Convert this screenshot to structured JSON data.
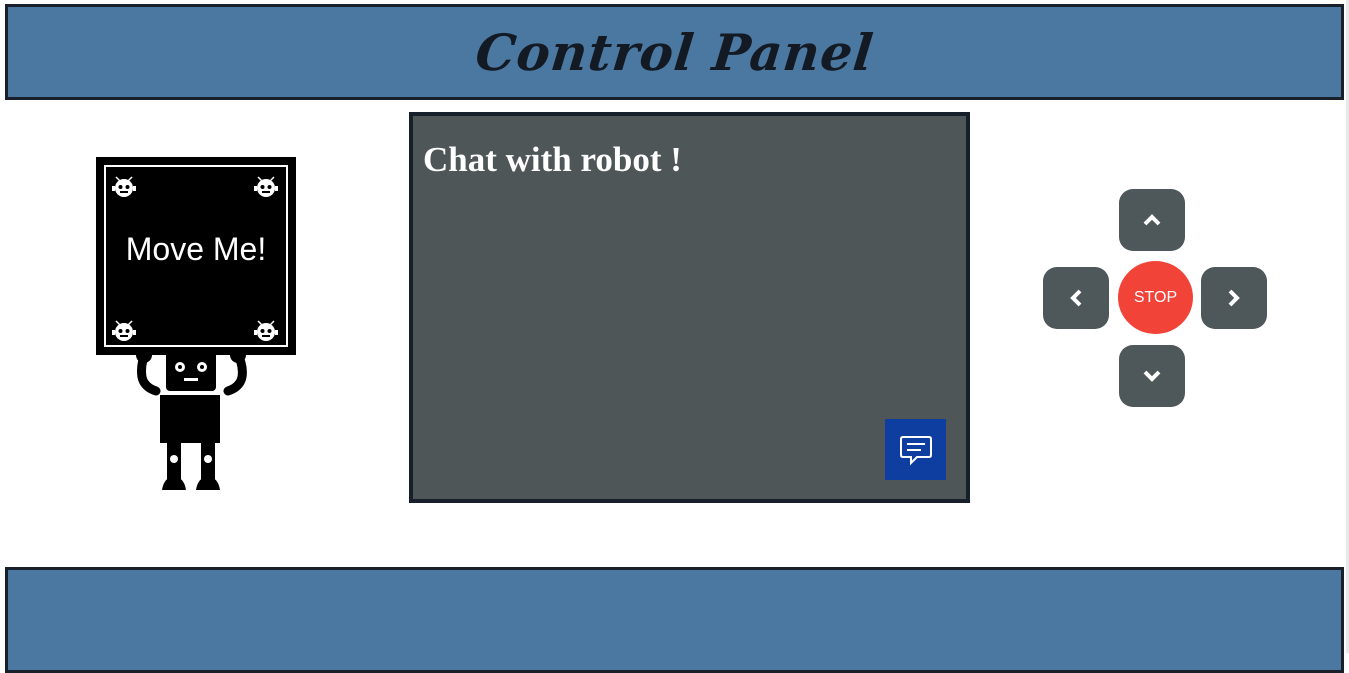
{
  "header": {
    "title": "Control Panel"
  },
  "robot": {
    "sign_label": "Move Me!"
  },
  "chat": {
    "title": "Chat with robot !",
    "button_icon": "chat-bubble-icon"
  },
  "controls": {
    "up_icon": "chevron-up-icon",
    "down_icon": "chevron-down-icon",
    "left_icon": "chevron-left-icon",
    "right_icon": "chevron-right-icon",
    "stop_label": "STOP"
  },
  "colors": {
    "header_bg": "#4a78a0",
    "border": "#19202a",
    "chat_bg": "#4f5657",
    "chat_button": "#0e3fa0",
    "dpad_button": "#4e5759",
    "stop_button": "#f24339"
  }
}
